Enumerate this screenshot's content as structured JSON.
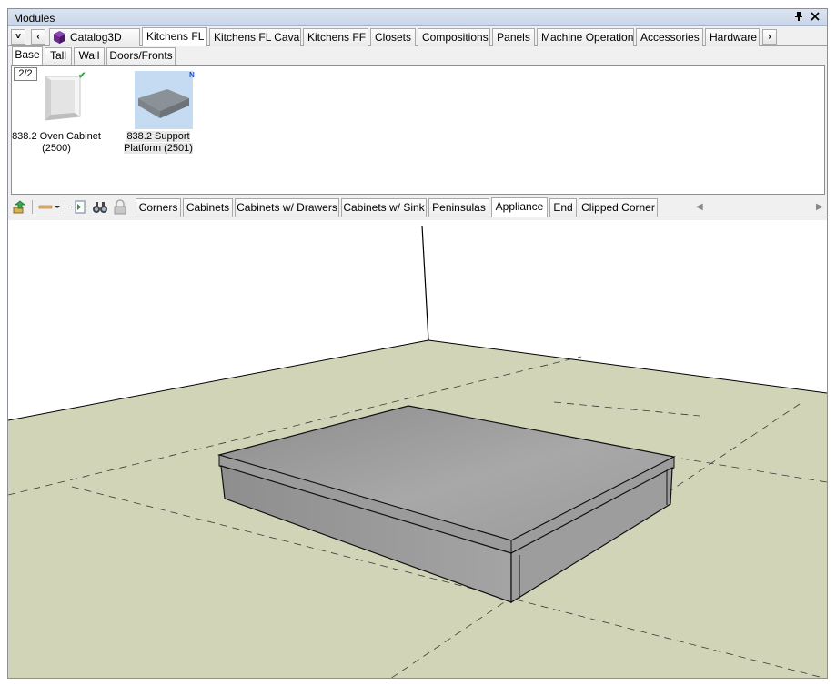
{
  "window": {
    "title": "Modules",
    "pin_icon": "pin-icon",
    "close_icon": "close-icon"
  },
  "nav": {
    "dropdown_icon": "chevron-down-icon",
    "prev_icon": "chevron-left-icon",
    "next_icon": "chevron-right-icon"
  },
  "main_tabs": [
    {
      "label": "Catalog3D",
      "icon": "cube-icon"
    },
    {
      "label": "Kitchens FL",
      "active": true
    },
    {
      "label": "Kitchens FL Cava"
    },
    {
      "label": "Kitchens FF"
    },
    {
      "label": "Closets"
    },
    {
      "label": "Compositions"
    },
    {
      "label": "Panels"
    },
    {
      "label": "Machine Operation"
    },
    {
      "label": "Accessories"
    },
    {
      "label": "Hardware"
    }
  ],
  "sub_tabs": [
    {
      "label": "Base",
      "active": true
    },
    {
      "label": "Tall"
    },
    {
      "label": "Wall"
    },
    {
      "label": "Doors/Fronts"
    }
  ],
  "catalog": {
    "counter": "2/2",
    "items": [
      {
        "line1": "838.2 Oven Cabinet",
        "line2": "(2500)",
        "badge": "check-icon"
      },
      {
        "line1": "838.2 Support",
        "line2": "Platform (2501)",
        "badge": "N",
        "selected": true
      }
    ]
  },
  "category_tabs": [
    {
      "label": "Corners"
    },
    {
      "label": "Cabinets"
    },
    {
      "label": "Cabinets w/ Drawers"
    },
    {
      "label": "Cabinets w/ Sink"
    },
    {
      "label": "Peninsulas"
    },
    {
      "label": "Appliance",
      "active": true
    },
    {
      "label": "End"
    },
    {
      "label": "Clipped Corner"
    }
  ],
  "toolbar_icons": [
    "insert-module-icon",
    "line-style-icon",
    "import-icon",
    "find-icon",
    "lock-icon"
  ],
  "colors": {
    "floor": "#d2d4b8",
    "model": "#a0a0a0",
    "active_item_bg": "#c5dbf1"
  }
}
